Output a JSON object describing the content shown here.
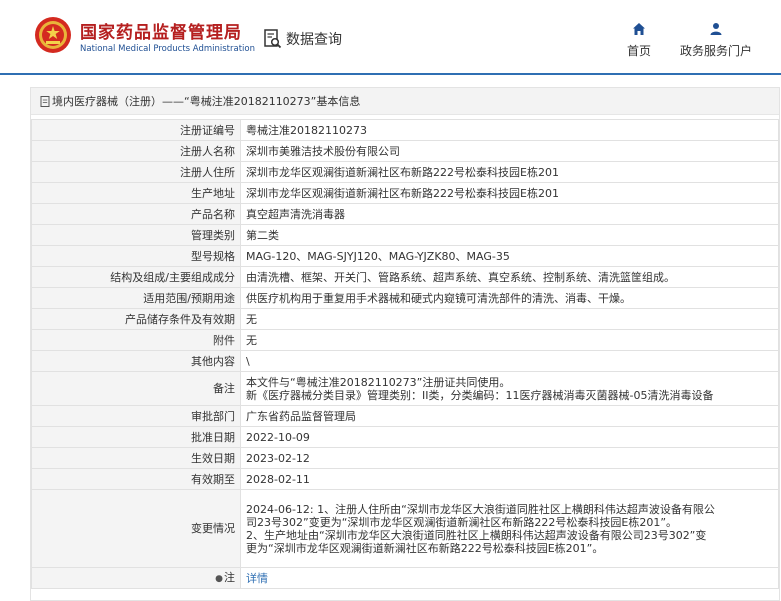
{
  "header": {
    "org_cn": "国家药品监督管理局",
    "org_en": "National Medical Products Administration",
    "query_label": "数据查询",
    "nav": [
      {
        "label": "首页",
        "icon": "home-icon"
      },
      {
        "label": "政务服务门户",
        "icon": "user-icon"
      }
    ]
  },
  "panel": {
    "title": "境内医疗器械（注册）——“粤械注准20182110273”基本信息"
  },
  "rows": [
    {
      "key": "注册证编号",
      "value": "粤械注准20182110273"
    },
    {
      "key": "注册人名称",
      "value": "深圳市美雅洁技术股份有限公司"
    },
    {
      "key": "注册人住所",
      "value": "深圳市龙华区观澜街道新澜社区布新路222号松泰科技园E栋201"
    },
    {
      "key": "生产地址",
      "value": "深圳市龙华区观澜街道新澜社区布新路222号松泰科技园E栋201"
    },
    {
      "key": "产品名称",
      "value": "真空超声清洗消毒器"
    },
    {
      "key": "管理类别",
      "value": "第二类"
    },
    {
      "key": "型号规格",
      "value": "MAG-120、MAG-SJYJ120、MAG-YJZK80、MAG-35"
    },
    {
      "key": "结构及组成/主要组成成分",
      "value": "由清洗槽、框架、开关门、管路系统、超声系统、真空系统、控制系统、清洗篮筐组成。"
    },
    {
      "key": "适用范围/预期用途",
      "value": "供医疗机构用于重复用手术器械和硬式内窥镜可清洗部件的清洗、消毒、干燥。"
    },
    {
      "key": "产品储存条件及有效期",
      "value": "无"
    },
    {
      "key": "附件",
      "value": "无"
    },
    {
      "key": "其他内容",
      "value": "\\"
    },
    {
      "key": "备注",
      "lines": [
        "本文件与“粤械注准20182110273”注册证共同使用。",
        "新《医疗器械分类目录》管理类别：II类，分类编码：11医疗器械消毒灭菌器械-05清洗消毒设备"
      ]
    },
    {
      "key": "审批部门",
      "value": "广东省药品监督管理局"
    },
    {
      "key": "批准日期",
      "value": "2022-10-09"
    },
    {
      "key": "生效日期",
      "value": "2023-02-12"
    },
    {
      "key": "有效期至",
      "value": "2028-02-11"
    },
    {
      "key": "变更情况",
      "lines": [
        "2024-06-12: 1、注册人住所由“深圳市龙华区大浪街道同胜社区上横朗科伟达超声波设备有限公",
        "司23号302”变更为“深圳市龙华区观澜街道新澜社区布新路222号松泰科技园E栋201”。",
        "2、生产地址由“深圳市龙华区大浪街道同胜社区上横朗科伟达超声波设备有限公司23号302”变",
        "更为“深圳市龙华区观澜街道新澜社区布新路222号松泰科技园E栋201”。"
      ]
    },
    {
      "key": "注",
      "value": "详情"
    }
  ]
}
